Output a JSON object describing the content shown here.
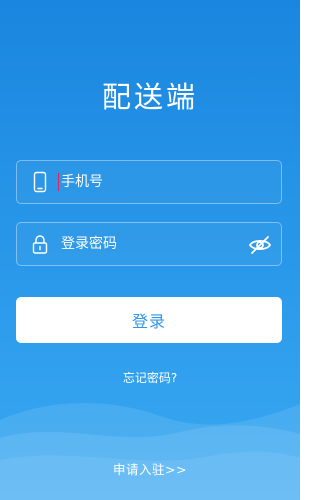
{
  "app": {
    "title": "配送端"
  },
  "login_form": {
    "phone_placeholder": "手机号",
    "phone_value": "",
    "phone_icon": "mobile-phone-icon",
    "password_placeholder": "登录密码",
    "password_value": "",
    "password_icon": "lock-icon",
    "visibility_icon": "eye-off-icon",
    "submit_label": "登录"
  },
  "links": {
    "forgot_password": "忘记密码?",
    "apply_join": "申请入驻>>"
  },
  "colors": {
    "background_top": "#1a86df",
    "background_bottom": "#3aa9f2",
    "button_background": "#ffffff",
    "button_text": "#3196e6",
    "caret": "#e0245e"
  }
}
